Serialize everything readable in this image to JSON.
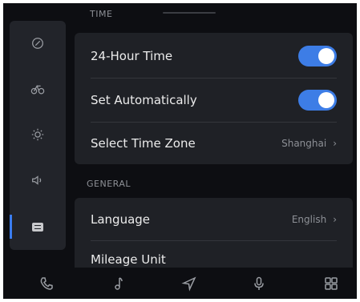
{
  "sections": {
    "time_header": "TIME",
    "general_header": "GENERAL"
  },
  "time_settings": {
    "hour24": {
      "label": "24-Hour Time",
      "enabled": true
    },
    "set_auto": {
      "label": "Set Automatically",
      "enabled": true
    },
    "time_zone": {
      "label": "Select Time Zone",
      "value": "Shanghai"
    }
  },
  "general_settings": {
    "language": {
      "label": "Language",
      "value": "English"
    },
    "mileage": {
      "label": "Mileage Unit"
    }
  },
  "chevron": "›",
  "sidebar": {
    "items": [
      {
        "icon": "disc-icon"
      },
      {
        "icon": "bicycle-icon"
      },
      {
        "icon": "brightness-icon"
      },
      {
        "icon": "speaker-icon"
      },
      {
        "icon": "settings-list-icon",
        "active": true
      }
    ]
  },
  "dock": {
    "items": [
      "phone-icon",
      "music-note-icon",
      "navigation-icon",
      "microphone-icon",
      "app-grid-icon"
    ]
  },
  "colors": {
    "accent": "#3d7de6",
    "card": "#1f2126",
    "background": "#0d0e12"
  }
}
